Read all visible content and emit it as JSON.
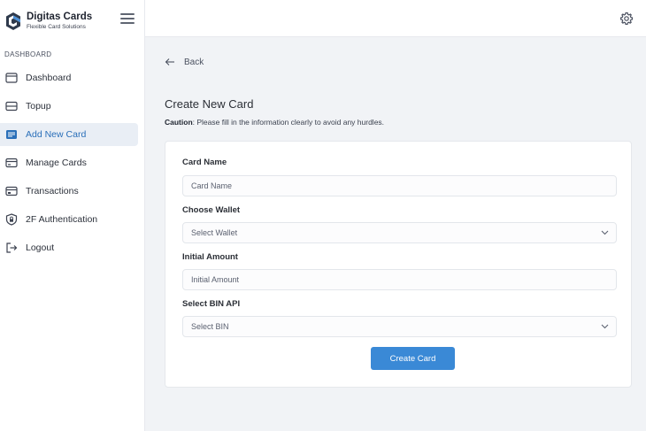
{
  "brand": {
    "name": "Digitas Cards",
    "tagline": "Flexible Card Solutions"
  },
  "sidebar": {
    "section_label": "DASHBOARD",
    "items": [
      {
        "label": "Dashboard",
        "icon": "dashboard-icon"
      },
      {
        "label": "Topup",
        "icon": "topup-icon"
      },
      {
        "label": "Add New Card",
        "icon": "add-card-icon",
        "active": true
      },
      {
        "label": "Manage Cards",
        "icon": "card-icon"
      },
      {
        "label": "Transactions",
        "icon": "transactions-icon"
      },
      {
        "label": "2F Authentication",
        "icon": "shield-icon"
      },
      {
        "label": "Logout",
        "icon": "logout-icon"
      }
    ]
  },
  "topbar": {
    "settings_icon": "gear-icon"
  },
  "main": {
    "back_label": "Back",
    "title": "Create New Card",
    "caution_label": "Caution",
    "caution_text": ": Please fill in the information clearly to avoid any hurdles."
  },
  "form": {
    "card_name": {
      "label": "Card Name",
      "placeholder": "Card Name"
    },
    "wallet": {
      "label": "Choose Wallet",
      "value": "Select Wallet"
    },
    "amount": {
      "label": "Initial Amount",
      "placeholder": "Initial Amount"
    },
    "bin": {
      "label": "Select BIN API",
      "value": "Select BIN"
    },
    "submit_label": "Create Card"
  },
  "colors": {
    "accent": "#3a89d6",
    "active_bg": "#e9eef5",
    "active_text": "#2a6fb9"
  }
}
